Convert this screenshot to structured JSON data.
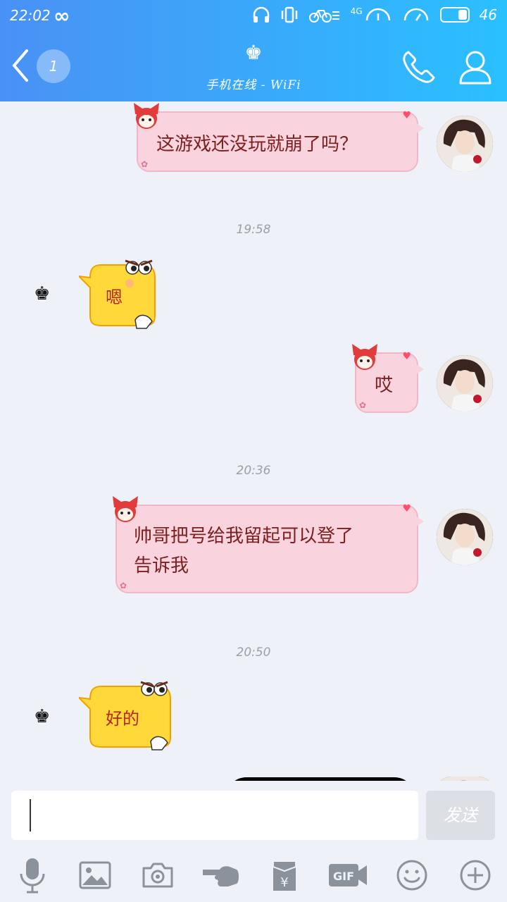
{
  "status_bar": {
    "time": "22:02",
    "battery": "46",
    "network": "4G",
    "icons": [
      "infinity-icon",
      "headphones-icon",
      "vibrate-icon",
      "bicycle-icon",
      "signal-icon",
      "battery-icon"
    ]
  },
  "header": {
    "unread_badge": "1",
    "subtitle": "手机在线 - WiFi",
    "icons": [
      "back-icon",
      "crown-icon",
      "phone-icon",
      "profile-icon"
    ]
  },
  "messages": [
    {
      "side": "right",
      "text": "这游戏还没玩就崩了吗？"
    },
    {
      "type": "time",
      "text": "19:58"
    },
    {
      "side": "left",
      "sticker": "嗯"
    },
    {
      "side": "right",
      "text": "哎"
    },
    {
      "type": "time",
      "text": "20:36"
    },
    {
      "side": "right",
      "text_line1": "帅哥把号给我留起可以登了",
      "text_line2": "告诉我"
    },
    {
      "type": "time",
      "text": "20:50"
    },
    {
      "side": "left",
      "sticker": "好的"
    }
  ],
  "input": {
    "value": "",
    "send_label": "发送"
  },
  "toolbar": [
    "mic-icon",
    "image-icon",
    "camera-icon",
    "poke-icon",
    "red-packet-icon",
    "gif-icon",
    "emoji-icon",
    "plus-icon"
  ],
  "colors": {
    "header_start": "#4a91f5",
    "header_end": "#2ac0ff",
    "bubble": "#f9d4de",
    "sticker": "#ffd93a"
  }
}
